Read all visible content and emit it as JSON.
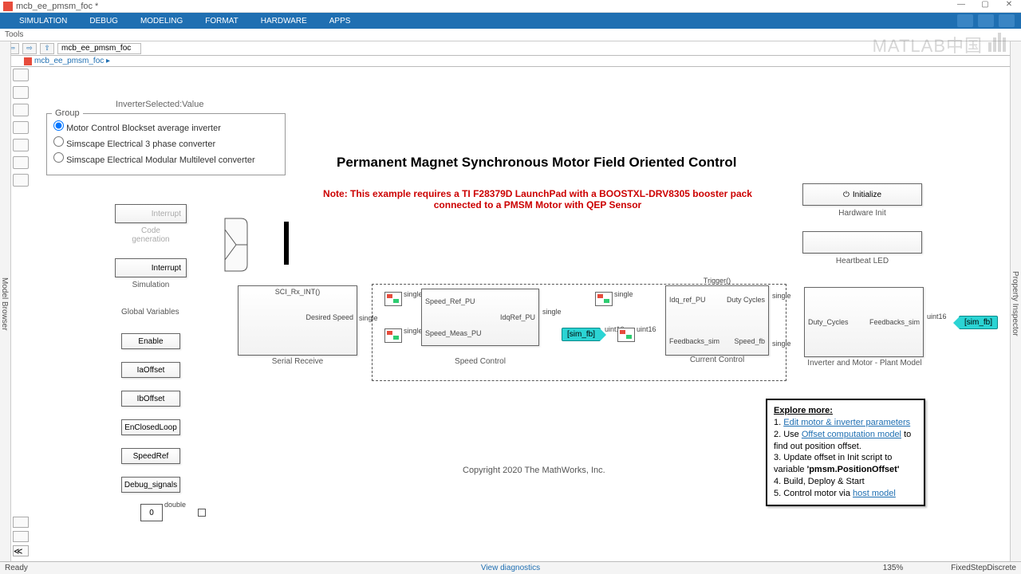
{
  "window": {
    "title": "mcb_ee_pmsm_foc *"
  },
  "toolstrip": {
    "tabs": [
      "SIMULATION",
      "DEBUG",
      "MODELING",
      "FORMAT",
      "HARDWARE",
      "APPS"
    ]
  },
  "toolsrow": "Tools",
  "breadcrumb": {
    "model": "mcb_ee_pmsm_foc"
  },
  "modelbar": {
    "name": "mcb_ee_pmsm_foc"
  },
  "leftstrip": "Model Browser",
  "rightstrip": "Property Inspector",
  "group": {
    "header": "InverterSelected:Value",
    "legend": "Group",
    "opts": [
      "Motor Control Blockset average inverter",
      "Simscape Electrical 3 phase converter",
      "Simscape Electrical Modular Multilevel converter"
    ]
  },
  "interrupt1": {
    "text": "Interrupt",
    "caption": "Code generation"
  },
  "interrupt2": {
    "text": "Interrupt",
    "caption": "Simulation"
  },
  "globals": {
    "title": "Global Variables",
    "items": [
      "Enable",
      "IaOffset",
      "IbOffset",
      "EnClosedLoop",
      "SpeedRef",
      "Debug_signals"
    ]
  },
  "const0": "0",
  "doublelbl": "double",
  "title": "Permanent Magnet Synchronous Motor Field Oriented Control",
  "rednote": "Note: This example requires a TI F28379D LaunchPad with a BOOSTXL-DRV8305 booster pack connected to a PMSM Motor with QEP Sensor",
  "serial": {
    "top": "SCI_Rx_INT()",
    "out": "Desired Speed",
    "caption": "Serial Receive"
  },
  "speed": {
    "in1": "Speed_Ref_PU",
    "in2": "Speed_Meas_PU",
    "out": "IdqRef_PU",
    "caption": "Speed Control"
  },
  "current": {
    "trig": "Trigger()",
    "in1": "Idq_ref_PU",
    "in2": "Feedbacks_sim",
    "out1": "Duty Cycles",
    "out2": "Speed_fb",
    "caption": "Current Control"
  },
  "plant": {
    "in": "Duty_Cycles",
    "out": "Feedbacks_sim",
    "caption": "Inverter and Motor - Plant Model"
  },
  "hwinit": {
    "btn": "Initialize",
    "caption": "Hardware Init"
  },
  "hb": {
    "caption": "Heartbeat LED"
  },
  "simfb": "[sim_fb]",
  "sig": {
    "single": "single",
    "uint16": "uint16"
  },
  "note": {
    "head": "Explore more:",
    "l1a": "1. ",
    "l1link": "Edit motor & inverter parameters",
    "l2a": "2. Use ",
    "l2link": "Offset computation model",
    "l2b": " to find out position offset.",
    "l3": "3. Update offset in Init script to variable ",
    "l3b": "'pmsm.PositionOffset'",
    "l4": "4. Build, Deploy & Start",
    "l5a": "5. Control motor via ",
    "l5link": "host model"
  },
  "copyright": "Copyright 2020 The MathWorks, Inc.",
  "status": {
    "ready": "Ready",
    "diag": "View diagnostics",
    "zoom": "135%",
    "solver": "FixedStepDiscrete"
  },
  "watermark": "MATLAB中国"
}
